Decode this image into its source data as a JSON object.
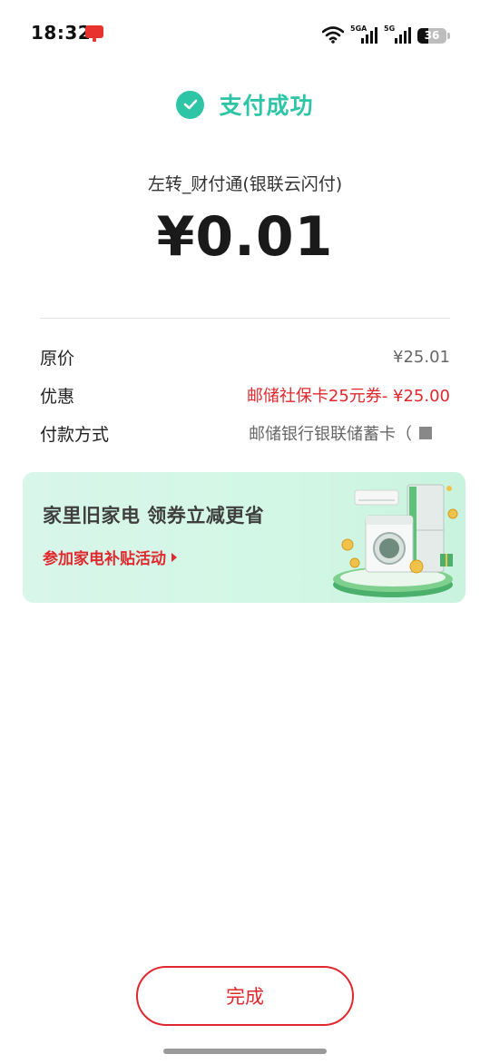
{
  "status_bar": {
    "time": "18:32",
    "sim1_label": "5GA",
    "sim2_label": "5G",
    "battery_level": "36",
    "battery_percent": 36
  },
  "header": {
    "status_text": "支付成功",
    "accent_color": "#2ec4a6"
  },
  "payment": {
    "merchant": "左转_财付通(银联云闪付)",
    "amount": "¥0.01"
  },
  "details": [
    {
      "label": "原价",
      "value": "¥25.01"
    },
    {
      "label": "优惠",
      "value": "邮储社保卡25元券- ¥25.00"
    },
    {
      "label": "付款方式",
      "value": "邮储银行银联储蓄卡（"
    }
  ],
  "banner": {
    "title": "家里旧家电 领券立减更省",
    "link": "参加家电补贴活动"
  },
  "actions": {
    "done_label": "完成",
    "brand_color": "#e0282e"
  }
}
